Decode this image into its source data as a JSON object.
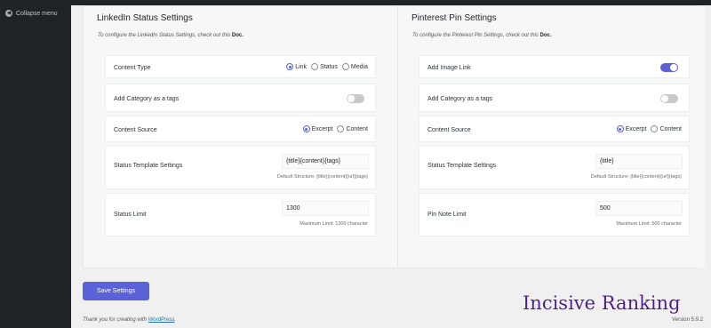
{
  "sidebar": {
    "collapse_label": "Collapse menu"
  },
  "linkedin": {
    "title": "LinkedIn Status Settings",
    "desc_prefix": "To configure the LinkedIn Status Settings, check out this",
    "desc_link": "Doc.",
    "content_type": {
      "label": "Content Type",
      "options": [
        "Link",
        "Status",
        "Media"
      ],
      "selected": "Link"
    },
    "add_category": {
      "label": "Add Category as a tags",
      "enabled": false
    },
    "content_source": {
      "label": "Content Source",
      "options": [
        "Excerpt",
        "Content"
      ],
      "selected": "Excerpt"
    },
    "template": {
      "label": "Status Template Settings",
      "value": "{title}{content}{tags}",
      "hint": "Default Structure: {title}{content}{url}{tags}"
    },
    "limit": {
      "label": "Status Limit",
      "value": "1300",
      "hint": "Maximum Limit: 1300 character"
    }
  },
  "pinterest": {
    "title": "Pinterest Pin Settings",
    "desc_prefix": "To configure the Pinterest Pin Settings, check out this",
    "desc_link": "Doc.",
    "add_image_link": {
      "label": "Add Image Link",
      "enabled": true
    },
    "add_category": {
      "label": "Add Category as a tags",
      "enabled": false
    },
    "content_source": {
      "label": "Content Source",
      "options": [
        "Excerpt",
        "Content"
      ],
      "selected": "Excerpt"
    },
    "template": {
      "label": "Status Template Settings",
      "value": "{title}",
      "hint": "Default Structure: {title}{content}{url}{tags}"
    },
    "limit": {
      "label": "Pin Note Limit",
      "value": "500",
      "hint": "Maximum Limit: 500 character"
    }
  },
  "save_label": "Save Settings",
  "footer": {
    "prefix": "Thank you for creating with",
    "link": "WordPress",
    "suffix": "."
  },
  "version": "Version 5.9.2",
  "watermark": "Incisive Ranking",
  "colors": {
    "accent": "#5b61d6",
    "sidebar": "#1d2327"
  }
}
